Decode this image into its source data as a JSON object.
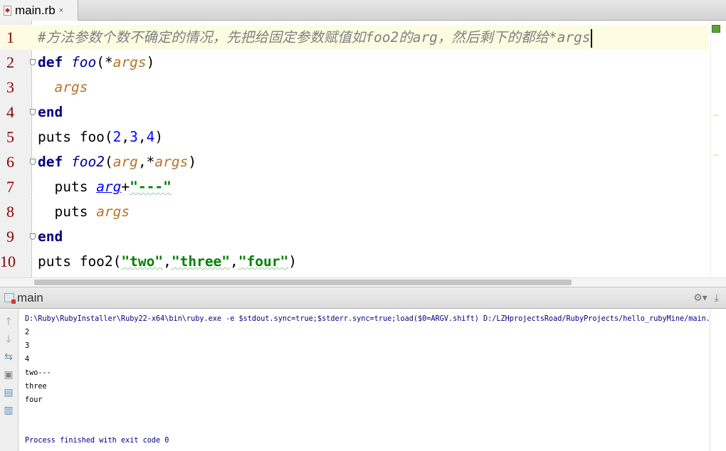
{
  "tab": {
    "filename": "main.rb",
    "close": "×",
    "icon": "ruby-file-icon"
  },
  "editor": {
    "lines": [
      {
        "num": "1",
        "current": true,
        "fold": false,
        "tokens": [
          {
            "t": "comment",
            "v": "#方法参数个数不确定的情况，先把给固定参数赋值如foo2的arg，然后剩下的都给*args"
          }
        ]
      },
      {
        "num": "2",
        "fold": true,
        "tokens": [
          {
            "t": "kw",
            "v": "def"
          },
          {
            "t": "plain",
            "v": " "
          },
          {
            "t": "fn",
            "v": "foo"
          },
          {
            "t": "plain",
            "v": "(*"
          },
          {
            "t": "param",
            "v": "args"
          },
          {
            "t": "plain",
            "v": ")"
          }
        ]
      },
      {
        "num": "3",
        "fold": false,
        "tokens": [
          {
            "t": "plain",
            "v": "  "
          },
          {
            "t": "param",
            "v": "args"
          }
        ]
      },
      {
        "num": "4",
        "fold": true,
        "tokens": [
          {
            "t": "kw",
            "v": "end"
          }
        ]
      },
      {
        "num": "5",
        "fold": false,
        "tokens": [
          {
            "t": "plain",
            "v": "puts foo("
          },
          {
            "t": "num",
            "v": "2"
          },
          {
            "t": "plain",
            "v": ","
          },
          {
            "t": "num",
            "v": "3"
          },
          {
            "t": "plain",
            "v": ","
          },
          {
            "t": "num",
            "v": "4"
          },
          {
            "t": "plain",
            "v": ")"
          }
        ]
      },
      {
        "num": "6",
        "fold": true,
        "tokens": [
          {
            "t": "kw",
            "v": "def"
          },
          {
            "t": "plain",
            "v": " "
          },
          {
            "t": "fn",
            "v": "foo2"
          },
          {
            "t": "plain",
            "v": "("
          },
          {
            "t": "param",
            "v": "arg"
          },
          {
            "t": "plain",
            "v": ",*"
          },
          {
            "t": "param",
            "v": "args"
          },
          {
            "t": "plain",
            "v": ")"
          }
        ]
      },
      {
        "num": "7",
        "fold": false,
        "tokens": [
          {
            "t": "plain",
            "v": "  puts "
          },
          {
            "t": "ref",
            "v": "arg"
          },
          {
            "t": "plain",
            "v": "+"
          },
          {
            "t": "str",
            "v": "\"---\""
          }
        ]
      },
      {
        "num": "8",
        "fold": false,
        "tokens": [
          {
            "t": "plain",
            "v": "  puts "
          },
          {
            "t": "param",
            "v": "args"
          }
        ]
      },
      {
        "num": "9",
        "fold": true,
        "tokens": [
          {
            "t": "kw",
            "v": "end"
          }
        ]
      },
      {
        "num": "10",
        "fold": false,
        "tokens": [
          {
            "t": "plain",
            "v": "puts foo2("
          },
          {
            "t": "str",
            "v": "\"two\""
          },
          {
            "t": "plain",
            "v": ","
          },
          {
            "t": "str",
            "v": "\"three\""
          },
          {
            "t": "plain",
            "v": ","
          },
          {
            "t": "str",
            "v": "\"four\""
          },
          {
            "t": "plain",
            "v": ")"
          }
        ]
      }
    ]
  },
  "run_panel": {
    "title": "main",
    "tools": [
      "settings-icon",
      "hide-icon"
    ],
    "left_tools": [
      "up-arrow-icon",
      "down-arrow-icon",
      "soft-wrap-icon",
      "scroll-to-end-icon",
      "print-icon",
      "trash-icon"
    ],
    "output": [
      {
        "kind": "cmd",
        "text": "D:\\Ruby\\RubyInstaller\\Ruby22-x64\\bin\\ruby.exe -e $stdout.sync=true;$stderr.sync=true;load($0=ARGV.shift) D:/LZHprojectsRoad/RubyProjects/hello_rubyMine/main.rb"
      },
      {
        "kind": "out",
        "text": "2"
      },
      {
        "kind": "out",
        "text": "3"
      },
      {
        "kind": "out",
        "text": "4"
      },
      {
        "kind": "out",
        "text": "two---"
      },
      {
        "kind": "out",
        "text": "three"
      },
      {
        "kind": "out",
        "text": "four"
      },
      {
        "kind": "blank",
        "text": ""
      },
      {
        "kind": "blank",
        "text": ""
      },
      {
        "kind": "proc",
        "text": "Process finished with exit code 0"
      }
    ]
  }
}
